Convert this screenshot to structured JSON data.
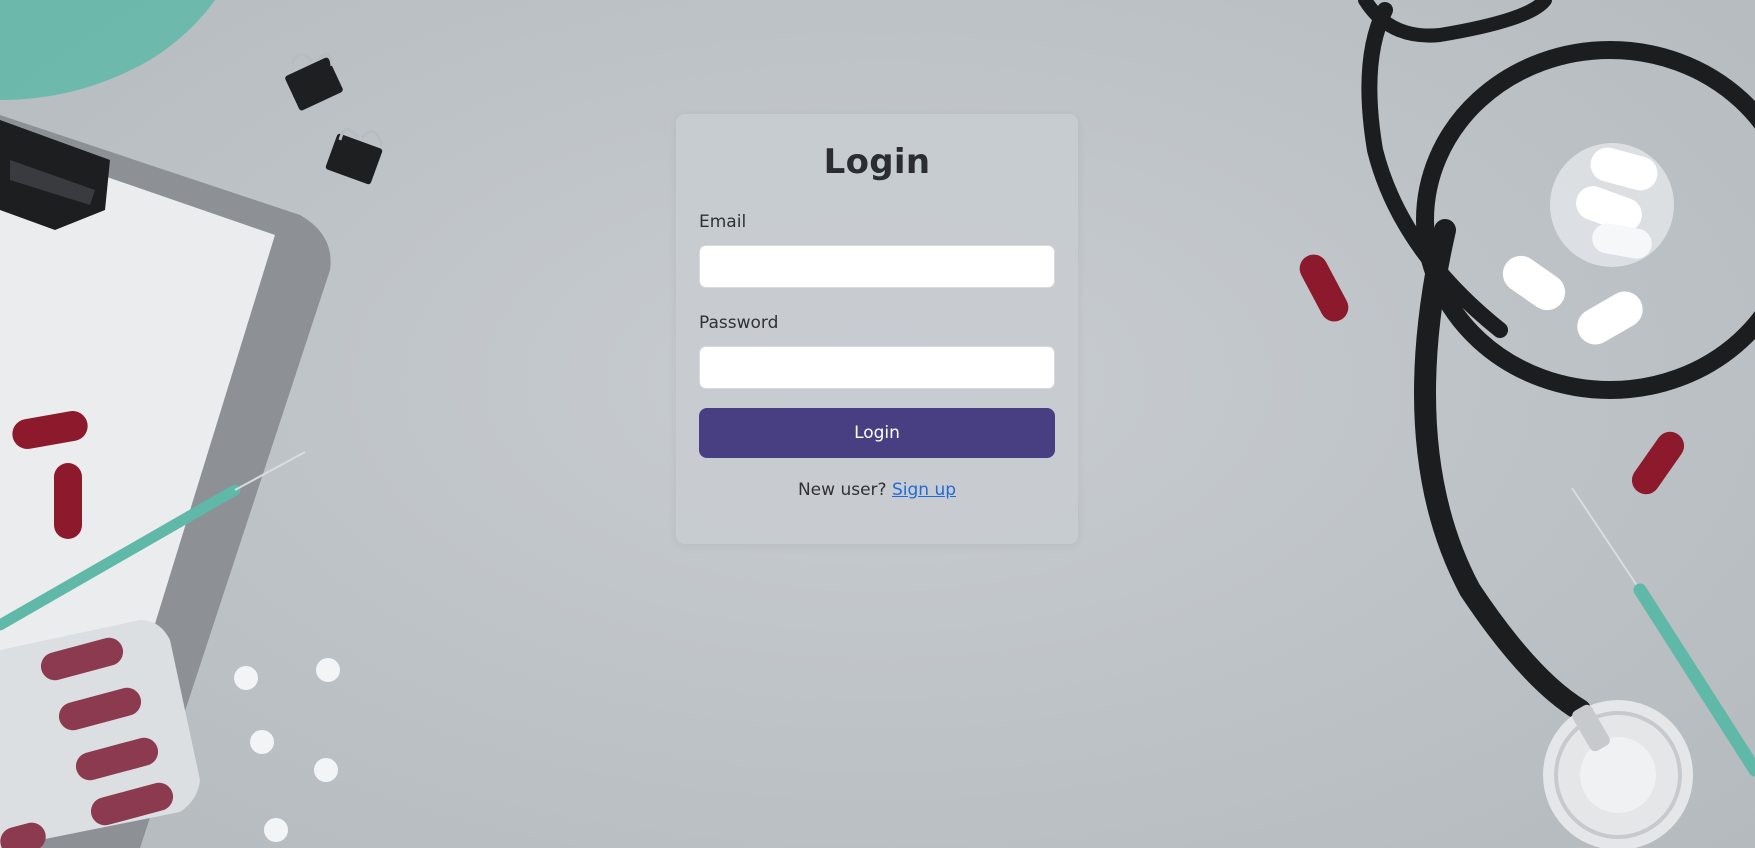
{
  "login_card": {
    "title": "Login",
    "email_label": "Email",
    "email_value": "",
    "password_label": "Password",
    "password_value": "",
    "submit_label": "Login",
    "new_user_prompt": "New user?",
    "signup_link": "Sign up"
  },
  "colors": {
    "accent": "#473f82",
    "link": "#1f6bd8",
    "card_background": "#c8ccd1",
    "page_background": "#c0c5c9"
  },
  "background": {
    "description_icons": [
      "clipboard-icon",
      "binder-clip-icon",
      "capsule-icon",
      "syringe-icon",
      "pill-blister-icon",
      "stethoscope-icon",
      "pill-jar-icon",
      "tablet-icon"
    ]
  }
}
